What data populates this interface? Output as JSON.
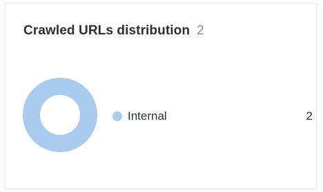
{
  "widget": {
    "title": "Crawled URLs distribution",
    "count": "2"
  },
  "chart_data": {
    "type": "pie",
    "categories": [
      "Internal"
    ],
    "values": [
      2
    ],
    "colors": [
      "#a9cbee"
    ]
  },
  "legend": {
    "items": [
      {
        "label": "Internal",
        "value": "2",
        "color": "#a9cbee",
        "icon": "legend-dot"
      }
    ]
  }
}
